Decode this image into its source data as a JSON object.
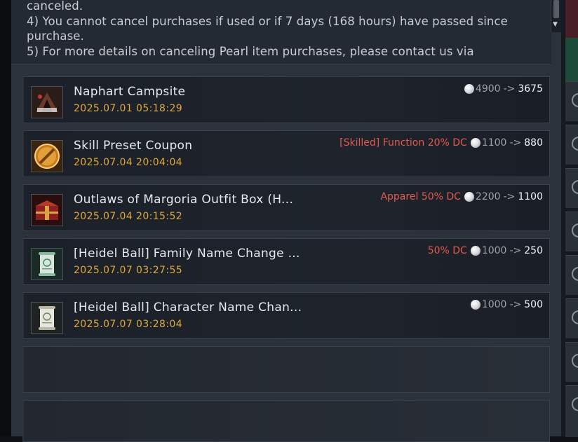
{
  "notice": {
    "lines": [
      "canceled.",
      "4) You cannot cancel purchases if used or if 7 days (168 hours) have passed since",
      "purchase.",
      "5) For more details on canceling Pearl item purchases, please contact us via"
    ]
  },
  "purchases": [
    {
      "name": "Naphart Campsite",
      "date": "2025.07.01 05:18:29",
      "discount": "",
      "old_price": "4900",
      "new_price": "3675",
      "arrow": "->",
      "icon": "campsite-icon"
    },
    {
      "name": "Skill Preset Coupon",
      "date": "2025.07.04 20:04:04",
      "discount": "[Skilled] Function 20% DC",
      "old_price": "1100",
      "new_price": "880",
      "arrow": "->",
      "icon": "skill-coupon-icon"
    },
    {
      "name": "Outlaws of Margoria Outfit Box (H...",
      "date": "2025.07.04 20:15:52",
      "discount": "Apparel 50% DC",
      "old_price": "2200",
      "new_price": "1100",
      "arrow": "->",
      "icon": "outfit-box-icon"
    },
    {
      "name": "[Heidel Ball] Family Name Change ...",
      "date": "2025.07.07 03:27:55",
      "discount": "50% DC",
      "old_price": "1000",
      "new_price": "250",
      "arrow": "->",
      "icon": "scroll-icon"
    },
    {
      "name": "[Heidel Ball] Character Name Chan...",
      "date": "2025.07.07 03:28:04",
      "discount": "",
      "old_price": "1000",
      "new_price": "500",
      "arrow": "->",
      "icon": "scroll-icon"
    }
  ],
  "colors": {
    "date": "#e0a93a",
    "discount": "#e25a4c",
    "name": "#e8e9ea"
  }
}
